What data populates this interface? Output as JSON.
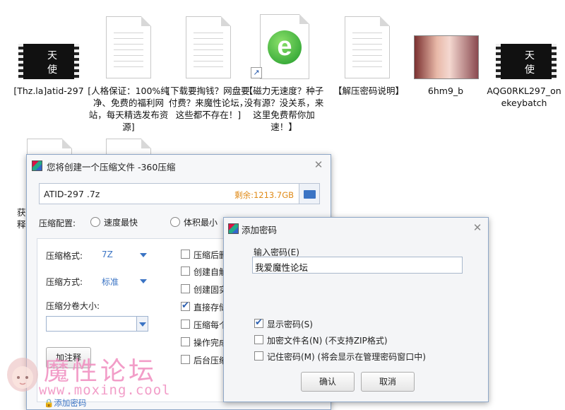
{
  "desktop": {
    "files": [
      {
        "label": "[Thz.la]atid-297",
        "kind": "video"
      },
      {
        "label": "[人格保证：100%纯净、免费的福利网站，每天精选发布资源]",
        "kind": "doc"
      },
      {
        "label": "[下载要掏钱？网盘要付费？来魔性论坛，这些都不存在！]",
        "kind": "doc"
      },
      {
        "label": "【磁力无速度？种子没有源？没关系，来这里免费帮你加速！】",
        "kind": "shortcut-ie"
      },
      {
        "label": "【解压密码说明】",
        "kind": "doc"
      },
      {
        "label": "6hm9_b",
        "kind": "image"
      },
      {
        "label": "AQG0RKL297_onekeybatch",
        "kind": "video"
      }
    ],
    "row2_partial": [
      {
        "label": "获\n释",
        "kind": "doc"
      },
      {
        "label": "",
        "kind": "doc"
      }
    ]
  },
  "compress_window": {
    "title": "您将创建一个压缩文件 -360压缩",
    "filename": "ATID-297 .7z",
    "remaining": "剩余:1213.7GB",
    "config_label": "压缩配置:",
    "config_options": [
      "速度最快",
      "体积最小"
    ],
    "format_label": "压缩格式:",
    "format_value": "7Z",
    "method_label": "压缩方式:",
    "method_value": "标准",
    "split_label": "压缩分卷大小:",
    "comment_button": "加注释",
    "add_password_link": "添加密码",
    "options": [
      {
        "label": "压缩后删",
        "checked": false
      },
      {
        "label": "创建自解",
        "checked": false
      },
      {
        "label": "创建固实",
        "checked": false
      },
      {
        "label": "直接存储",
        "checked": true
      },
      {
        "label": "压缩每个",
        "checked": false
      },
      {
        "label": "操作完成",
        "checked": false
      },
      {
        "label": "后台压缩",
        "checked": false
      }
    ]
  },
  "password_dialog": {
    "title": "添加密码",
    "input_label": "输入密码(E)",
    "password_value": "我爱魔性论坛",
    "options": [
      {
        "label": "显示密码(S)",
        "checked": true
      },
      {
        "label": "加密文件名(N) (不支持ZIP格式)",
        "checked": false
      },
      {
        "label": "记住密码(M) (将会显示在管理密码窗口中)",
        "checked": false
      }
    ],
    "ok_button": "确认",
    "cancel_button": "取消"
  },
  "watermark": {
    "text": "魔性论坛",
    "url": "www.moxing.cool"
  },
  "colors": {
    "accent": "#3b74c4",
    "remaining": "#e08a17",
    "watermark": "#f08cbf"
  }
}
